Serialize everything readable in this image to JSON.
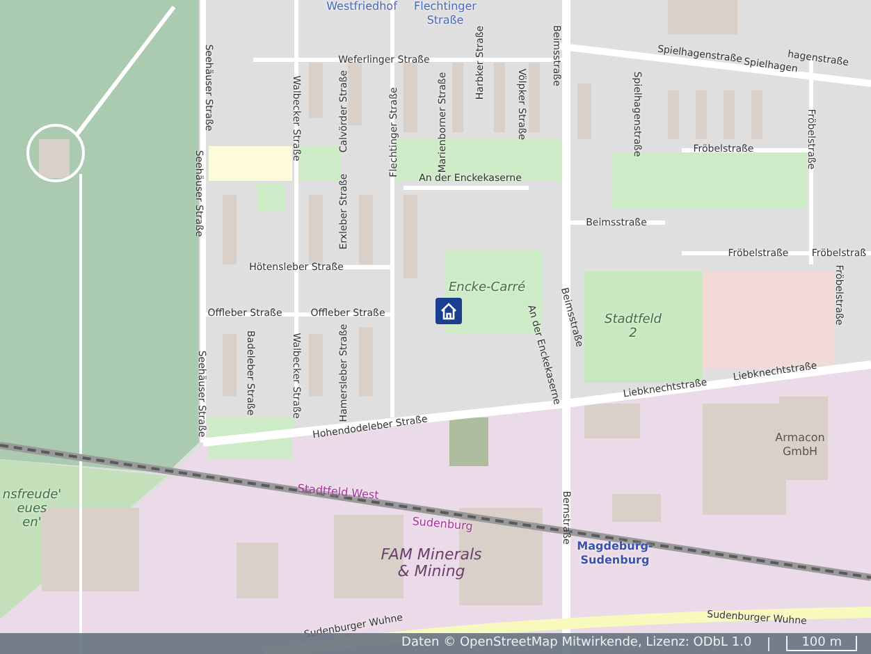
{
  "map_labels": [
    {
      "text": "Westfriedhof",
      "kind": "place"
    },
    {
      "text": "Flechtinger\nStraße",
      "kind": "place"
    },
    {
      "text": "Weferlinger Straße",
      "kind": "street"
    },
    {
      "text": "Calvörder Straße",
      "kind": "street"
    },
    {
      "text": "Seehäuser Straße",
      "kind": "street"
    },
    {
      "text": "Walbecker Straße",
      "kind": "street"
    },
    {
      "text": "Flechtinger Straße",
      "kind": "street"
    },
    {
      "text": "Marienborner Straße",
      "kind": "street"
    },
    {
      "text": "Harbker Straße",
      "kind": "street"
    },
    {
      "text": "Völpker Straße",
      "kind": "street"
    },
    {
      "text": "Beimsstraße",
      "kind": "street"
    },
    {
      "text": "Spielhagenstraße",
      "kind": "street"
    },
    {
      "text": "Spielhagenstraße",
      "kind": "street"
    },
    {
      "text": "Spielhagen",
      "kind": "street"
    },
    {
      "text": "hagenstraße",
      "kind": "street"
    },
    {
      "text": "Fröbelstraße",
      "kind": "street"
    },
    {
      "text": "Fröbelstraße",
      "kind": "street"
    },
    {
      "text": "An der Enckekaserne",
      "kind": "street"
    },
    {
      "text": "Beimsstraße",
      "kind": "street"
    },
    {
      "text": "Fröbelstraße",
      "kind": "street"
    },
    {
      "text": "Fröbelstraß",
      "kind": "street"
    },
    {
      "text": "Fröbelstraße",
      "kind": "street"
    },
    {
      "text": "Seehäuser Straße",
      "kind": "street"
    },
    {
      "text": "Hötensleber Straße",
      "kind": "street"
    },
    {
      "text": "Erxleber Straße",
      "kind": "street"
    },
    {
      "text": "Offleber Straße",
      "kind": "street"
    },
    {
      "text": "Offleber Straße",
      "kind": "street"
    },
    {
      "text": "Encke-Carré",
      "kind": "area"
    },
    {
      "text": "Stadtfeld\n2",
      "kind": "area"
    },
    {
      "text": "Beimsstraße",
      "kind": "street"
    },
    {
      "text": "An der Enckekaserne",
      "kind": "street"
    },
    {
      "text": "Badeleber Straße",
      "kind": "street"
    },
    {
      "text": "Walbecker Straße",
      "kind": "street"
    },
    {
      "text": "Hamersleber Straße",
      "kind": "street"
    },
    {
      "text": "Seehäuser Straße",
      "kind": "street"
    },
    {
      "text": "Liebknechtstraße",
      "kind": "street"
    },
    {
      "text": "Liebknechtstraße",
      "kind": "street"
    },
    {
      "text": "Hohendodeleber Straße",
      "kind": "street"
    },
    {
      "text": "Stadtfeld West",
      "kind": "district"
    },
    {
      "text": "nsfreude'\neues\nen'",
      "kind": "area"
    },
    {
      "text": "Sudenburg",
      "kind": "district"
    },
    {
      "text": "FAM Minerals\n& Mining",
      "kind": "company"
    },
    {
      "text": "Armacon\nGmbH",
      "kind": "building"
    },
    {
      "text": "Magdeburg-\nSudenburg",
      "kind": "station"
    },
    {
      "text": "Bernstraße",
      "kind": "street"
    },
    {
      "text": "Sudenburger Wuhne",
      "kind": "street"
    },
    {
      "text": "Sudenburger Wuhne",
      "kind": "street"
    }
  ],
  "attribution": "Daten © OpenStreetMap Mitwirkende, Lizenz: ODbL 1.0",
  "scale": "100 m"
}
